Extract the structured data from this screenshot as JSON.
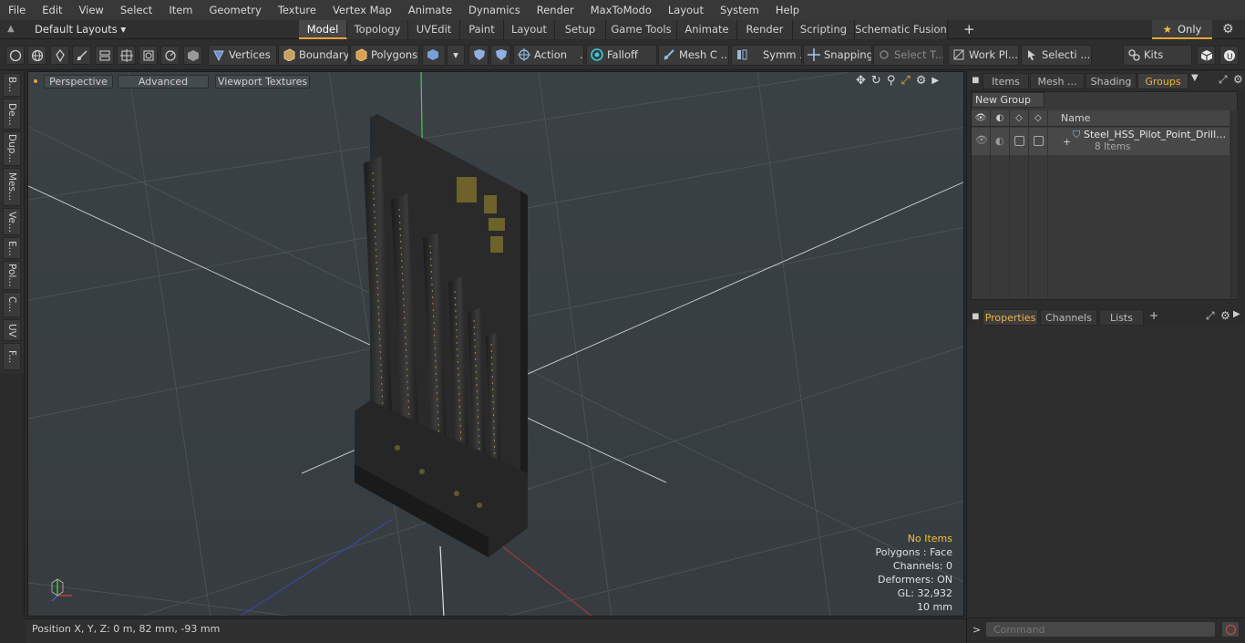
{
  "menu": [
    "File",
    "Edit",
    "View",
    "Select",
    "Item",
    "Geometry",
    "Texture",
    "Vertex Map",
    "Animate",
    "Dynamics",
    "Render",
    "MaxToModo",
    "Layout",
    "System",
    "Help"
  ],
  "layout_selector": "Default Layouts ▾",
  "layout_tabs": [
    "Model",
    "Topology",
    "UVEdit",
    "Paint",
    "Layout",
    "Setup",
    "Game Tools",
    "Animate",
    "Render",
    "Scripting",
    "Schematic Fusion"
  ],
  "active_layout_tab": "Model",
  "only_label": "Only",
  "toolbar": {
    "vertices": "Vertices",
    "boundary": "Boundary",
    "polygons": "Polygons",
    "action": "Action",
    "action_more": "...",
    "falloff": "Falloff",
    "mesh_c": "Mesh C ...",
    "symm": "Symm ...",
    "snapping": "Snapping",
    "select_t": "Select T...",
    "work_pl": "Work Pl...",
    "selecti": "Selecti ...",
    "kits": "Kits"
  },
  "left_tabs": [
    "B...",
    "De...",
    "Dup...",
    "Mes...",
    "Ve...",
    "E...",
    "Pol...",
    "C...",
    "UV",
    "F..."
  ],
  "viewport": {
    "perspective": "Perspective",
    "advanced": "Advanced",
    "viewport_textures": "Viewport Textures",
    "info": {
      "no_items": "No Items",
      "polygons": "Polygons : Face",
      "channels": "Channels: 0",
      "deformers": "Deformers: ON",
      "gl": "GL: 32,932",
      "scale": "10 mm"
    }
  },
  "status": {
    "position": "Position X, Y, Z:   0 m, 82 mm, -93 mm"
  },
  "right_panel": {
    "tabs": [
      "Items",
      "Mesh ...",
      "Shading",
      "Groups"
    ],
    "active_tab": "Groups",
    "new_group": "New Group",
    "name_header": "Name",
    "group": {
      "name": "Steel_HSS_Pilot_Point_Drill_Bi ...",
      "count": "8 Items"
    },
    "props_tabs": [
      "Properties",
      "Channels",
      "Lists"
    ],
    "active_props_tab": "Properties",
    "command_placeholder": "Command"
  },
  "colors": {
    "accent": "#e8a33c",
    "viewport_bg": "#3a4044",
    "highlight_text": "#f0c040"
  }
}
